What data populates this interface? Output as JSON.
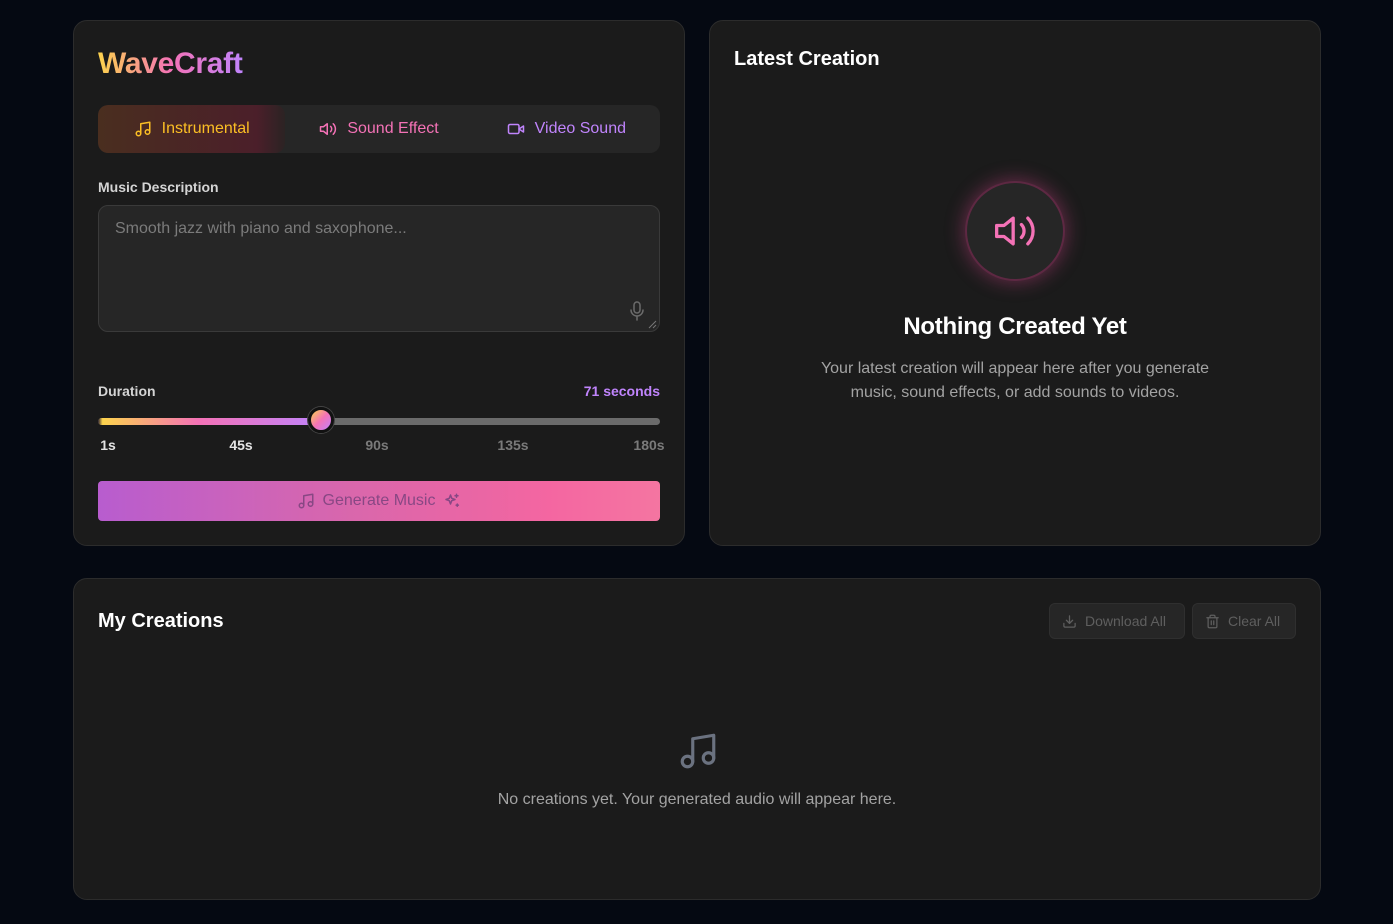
{
  "app": {
    "logo": "WaveCraft"
  },
  "tabs": [
    {
      "label": "Instrumental",
      "icon": "music-note-icon",
      "active": true,
      "color": "#fbbf24"
    },
    {
      "label": "Sound Effect",
      "icon": "speaker-icon",
      "active": false,
      "color": "#f472b6"
    },
    {
      "label": "Video Sound",
      "icon": "video-camera-icon",
      "active": false,
      "color": "#c084fc"
    }
  ],
  "description": {
    "label": "Music Description",
    "placeholder": "Smooth jazz with piano and saxophone...",
    "value": ""
  },
  "duration": {
    "label": "Duration",
    "value_text": "71 seconds",
    "value": 71,
    "min": 1,
    "max": 180,
    "ticks": [
      "1s",
      "45s",
      "90s",
      "135s",
      "180s"
    ]
  },
  "generate": {
    "label": "Generate Music"
  },
  "latest": {
    "title": "Latest Creation",
    "empty_title": "Nothing Created Yet",
    "empty_desc": "Your latest creation will appear here after you generate music, sound effects, or add sounds to videos."
  },
  "creations": {
    "title": "My Creations",
    "download_all": "Download All",
    "clear_all": "Clear All",
    "empty_text": "No creations yet. Your generated audio will appear here."
  },
  "colors": {
    "background": "#050912",
    "card": "#1b1b1b",
    "accent_yellow": "#fbbf24",
    "accent_pink": "#f472b6",
    "accent_purple": "#c084fc"
  }
}
